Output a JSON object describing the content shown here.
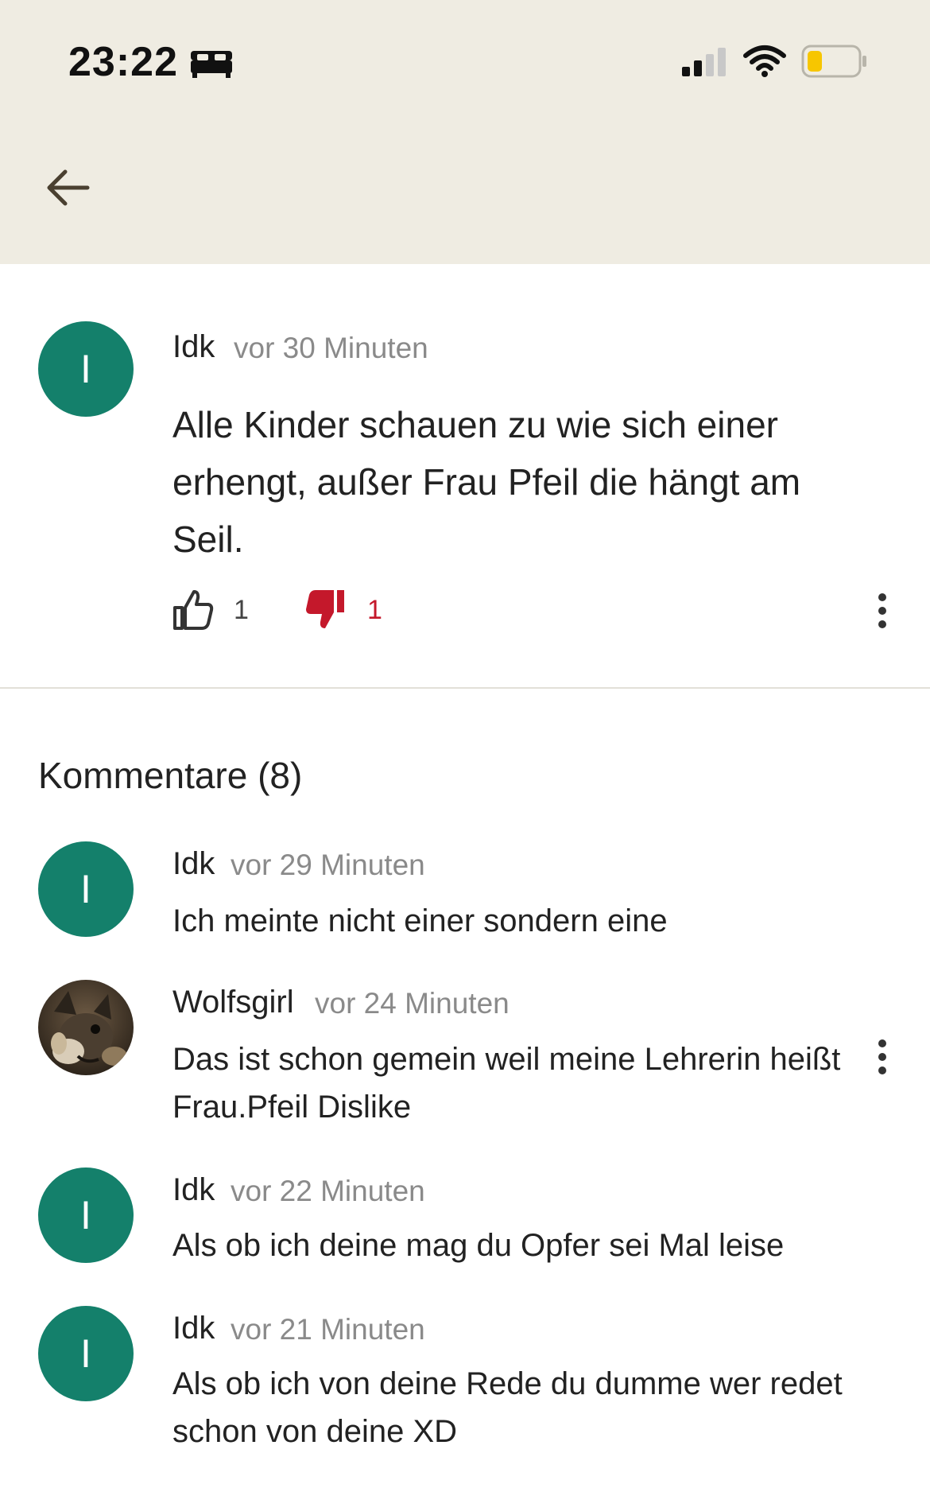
{
  "status_bar": {
    "time": "23:22",
    "focus_icon": "bed-icon",
    "signal_bars": 2,
    "battery_level": 0.25
  },
  "header": {
    "back_icon": "back-arrow-icon"
  },
  "post": {
    "avatar_initial": "I",
    "author": "Idk",
    "time": "vor 30 Minuten",
    "text": "Alle Kinder schauen zu wie sich einer erhengt, außer Frau Pfeil die hängt am Seil.",
    "likes": "1",
    "dislikes": "1"
  },
  "comments_heading": "Kommentare (8)",
  "comments": [
    {
      "avatar_initial": "I",
      "author": "Idk",
      "time": "vor 29 Minuten",
      "text": "Ich meinte nicht einer sondern eine"
    },
    {
      "avatar_initial": "",
      "author": "Wolfsgirl",
      "time": "vor 24 Minuten",
      "text": "Das ist schon gemein weil meine Lehrerin heißt Frau.Pfeil Dislike"
    },
    {
      "avatar_initial": "I",
      "author": "Idk",
      "time": "vor 22 Minuten",
      "text": "Als ob ich deine mag du Opfer sei Mal leise"
    },
    {
      "avatar_initial": "I",
      "author": "Idk",
      "time": "vor 21 Minuten",
      "text": "Als ob ich von deine Rede du dumme wer redet schon von deine XD"
    }
  ],
  "colors": {
    "avatar": "#14806b",
    "header_bg": "#efece2",
    "dislike": "#c4182b",
    "battery": "#f7c600"
  }
}
